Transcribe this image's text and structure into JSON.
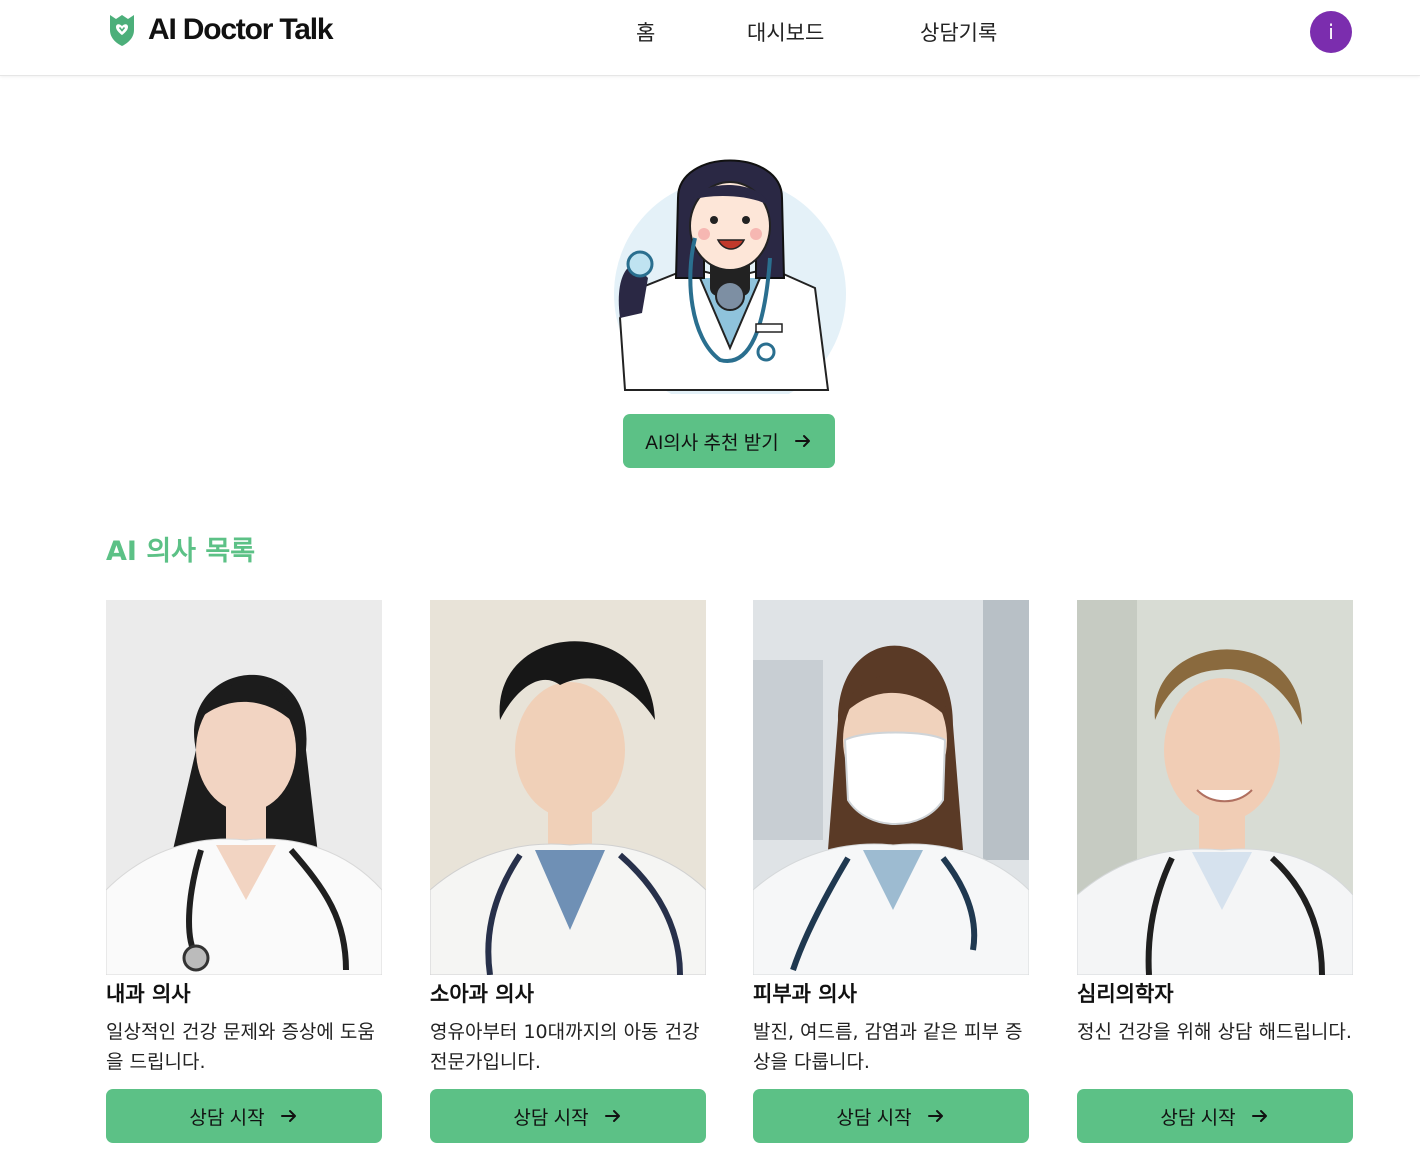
{
  "header": {
    "brand": "AI Doctor Talk",
    "nav": [
      {
        "label": "홈"
      },
      {
        "label": "대시보드"
      },
      {
        "label": "상담기록"
      }
    ],
    "avatar_initial": "i",
    "avatar_color": "#7b2dae"
  },
  "hero": {
    "illustration_icon": "doctor-robot-illustration",
    "cta_label": "AI의사 추천 받기",
    "cta_icon": "arrow-right-icon"
  },
  "doctors_section": {
    "title": "AI 의사 목록",
    "cards": [
      {
        "name": "내과 의사",
        "description": "일상적인 건강 문제와 증상에 도움을 드립니다.",
        "button": "상담 시작"
      },
      {
        "name": "소아과 의사",
        "description": "영유아부터 10대까지의 아동 건강 전문가입니다.",
        "button": "상담 시작"
      },
      {
        "name": "피부과 의사",
        "description": "발진, 여드름, 감염과 같은 피부 증상을 다룹니다.",
        "button": "상담 시작"
      },
      {
        "name": "심리의학자",
        "description": "정신 건강을 위해 상담 해드립니다.",
        "button": "상담 시작"
      }
    ]
  },
  "colors": {
    "accent": "#5cc186",
    "logo_green": "#4caf7a",
    "avatar": "#7b2dae"
  }
}
